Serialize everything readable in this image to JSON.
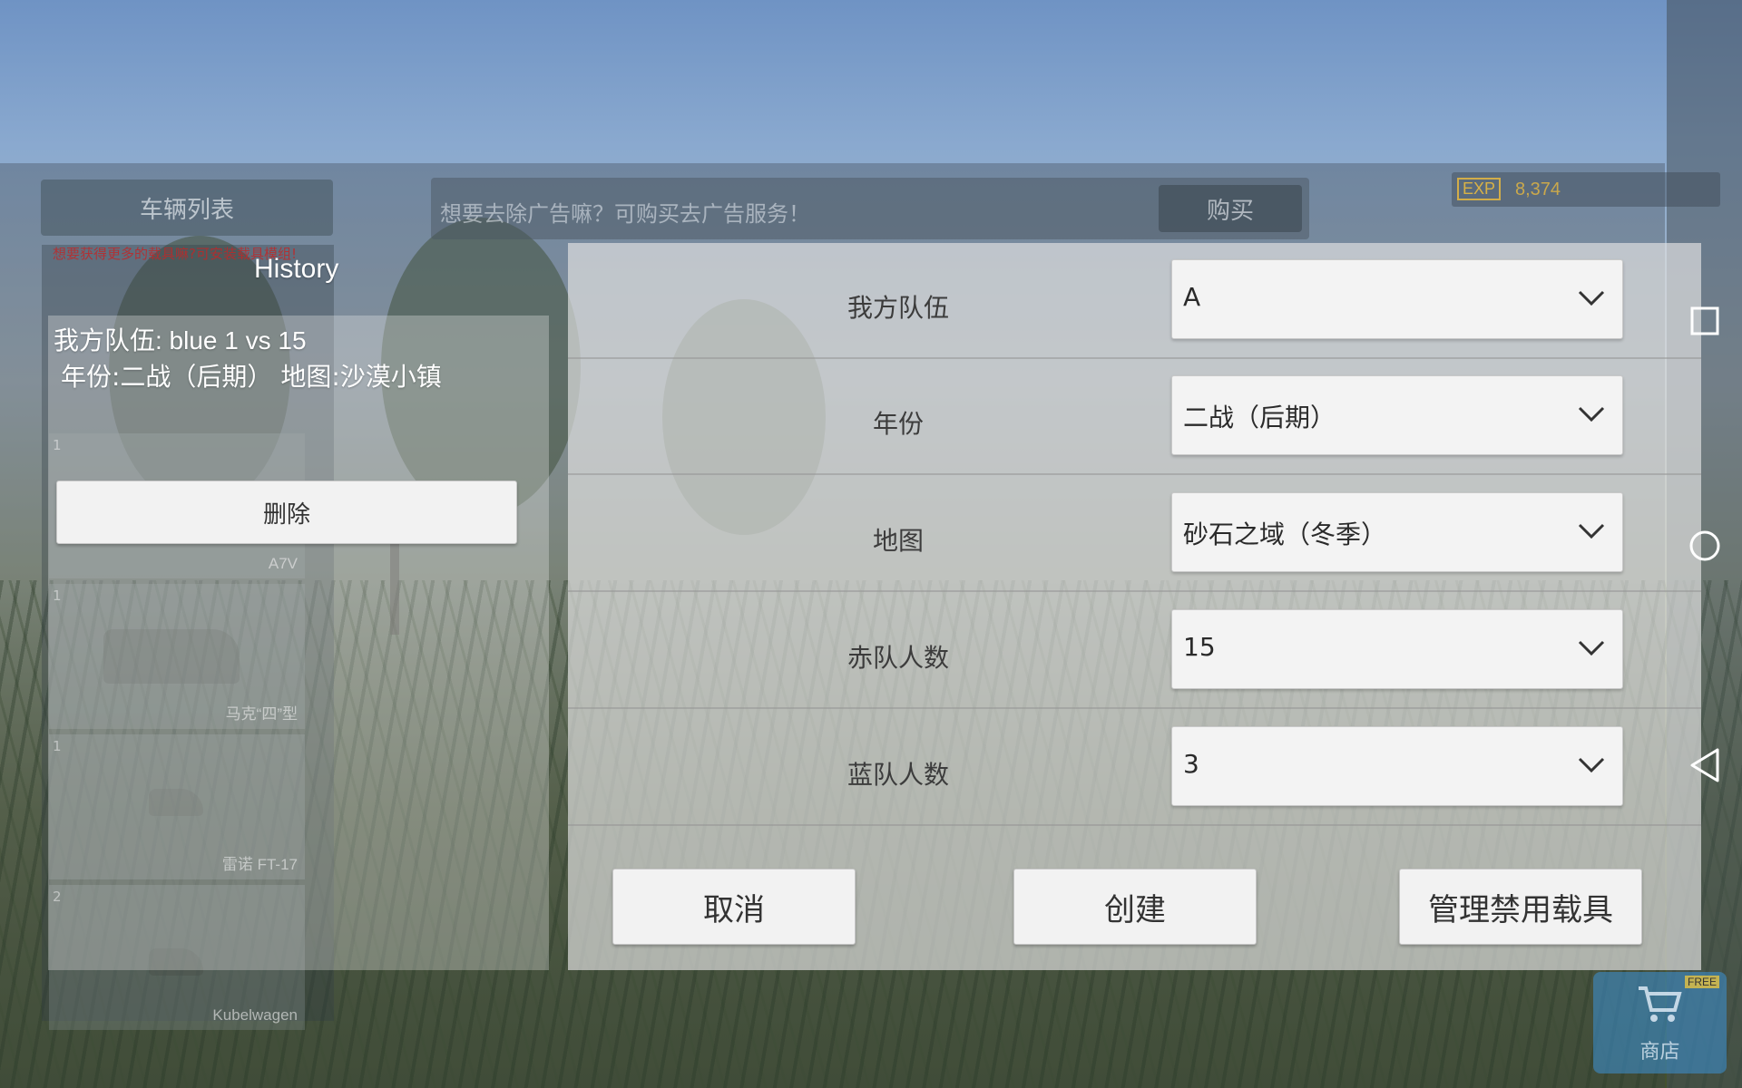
{
  "background_panel": {
    "vehicle_tab_label": "车辆列表",
    "ad_text": "想要去除广告嘛？可购买去广告服务！",
    "buy_label": "购买",
    "exp_badge": "EXP",
    "exp_value": "8,374",
    "red_note": "想要获得更多的载具嘛?可安装载具模组!",
    "vehicles": [
      {
        "num": "1",
        "name": "A7V"
      },
      {
        "num": "1",
        "name": "马克“四”型"
      },
      {
        "num": "1",
        "name": "雷诺 FT-17"
      },
      {
        "num": "2",
        "name": "Kubelwagen"
      }
    ],
    "shop_label": "商店",
    "shop_badge": "FREE"
  },
  "history": {
    "title": "History",
    "line1": "我方队伍: blue 1 vs 15",
    "line2": "年份:二战（后期） 地图:沙漠小镇",
    "delete_label": "删除"
  },
  "dialog": {
    "rows": [
      {
        "label": "我方队伍",
        "value": "A"
      },
      {
        "label": "年份",
        "value": "二战（后期）"
      },
      {
        "label": "地图",
        "value": "砂石之域（冬季）"
      },
      {
        "label": "赤队人数",
        "value": "15"
      },
      {
        "label": "蓝队人数",
        "value": "3"
      }
    ],
    "cancel_label": "取消",
    "create_label": "创建",
    "manage_label": "管理禁用载具"
  },
  "nav": {
    "icons": [
      "square-icon",
      "circle-icon",
      "back-triangle-icon"
    ]
  }
}
